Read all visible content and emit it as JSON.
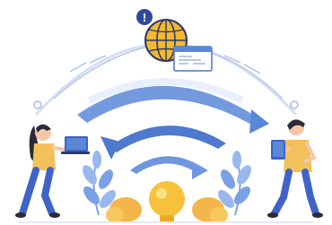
{
  "illustration": {
    "alert_badge": "!",
    "colors": {
      "globe_fill": "#f5b82e",
      "globe_stroke": "#2a3a6e",
      "arc_blue": "#5b87d8",
      "arc_light": "#dfe8fb",
      "leaf_blue": "#7aa0e6",
      "bulb_yellow": "#f7c23a",
      "leaf_orange": "#f3b64a",
      "person_shirt": "#f2c15b",
      "person_pants": "#3f63c7",
      "skin": "#f3c7a7",
      "hair": "#2a2a3a"
    },
    "icons": [
      "alert-icon",
      "globe-icon",
      "browser-window-icon",
      "wifi-signal-arcs",
      "light-bulb-icon",
      "laptop-icon",
      "tablet-icon"
    ]
  }
}
